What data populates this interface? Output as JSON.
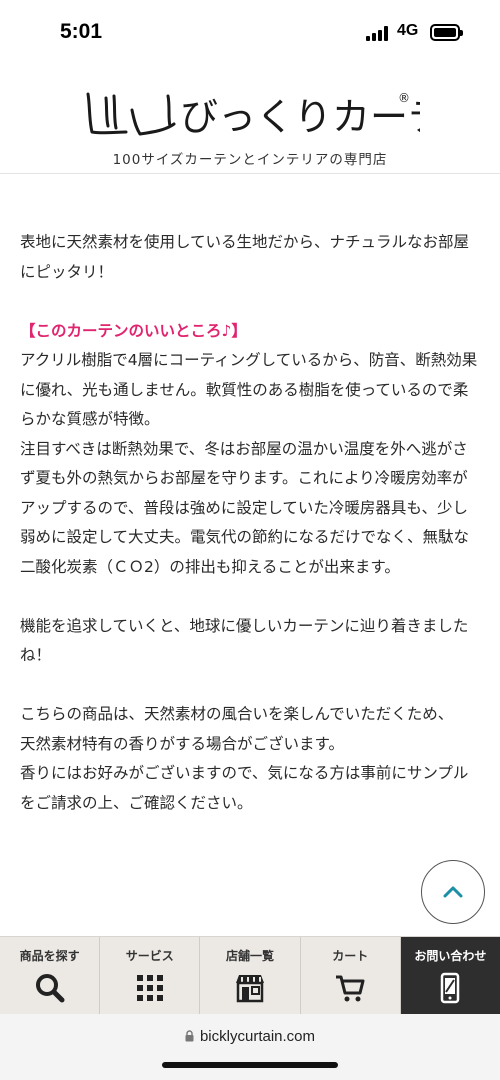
{
  "status_bar": {
    "time": "5:01",
    "network": "4G"
  },
  "header": {
    "tagline": "100サイズカーテンとインテリアの専門店",
    "logo_text": "びっくりカーテン",
    "logo_mark": "®"
  },
  "content": {
    "paragraph_1": "表地に天然素材を使用している生地だから、ナチュラルなお部屋にピッタリ！",
    "section_heading": "【このカーテンのいいところ♪】",
    "paragraph_2": "アクリル樹脂で4層にコーティングしているから、防音、断熱効果に優れ、光も通しません。軟質性のある樹脂を使っているので柔らかな質感が特徴。",
    "paragraph_3": "注目すべきは断熱効果で、冬はお部屋の温かい温度を外へ逃がさず夏も外の熱気からお部屋を守ります。これにより冷暖房効率がアップするので、普段は強めに設定していた冷暖房器具も、少し弱めに設定して大丈夫。電気代の節約になるだけでなく、無駄な二酸化炭素（ＣＯ2）の排出も抑えることが出来ます。",
    "paragraph_4": "機能を追求していくと、地球に優しいカーテンに辿り着きましたね！",
    "paragraph_5a": "こちらの商品は、天然素材の風合いを楽しんでいただくため、",
    "paragraph_5b": "天然素材特有の香りがする場合がございます。",
    "paragraph_5c": "香りにはお好みがございますので、気になる方は事前にサンプルをご請求の上、ご確認ください。"
  },
  "bottom_nav": {
    "items": [
      {
        "label": "商品を探す",
        "icon": "search-icon"
      },
      {
        "label": "サービス",
        "icon": "grid-icon"
      },
      {
        "label": "店舗一覧",
        "icon": "store-icon"
      },
      {
        "label": "カート",
        "icon": "cart-icon"
      },
      {
        "label": "お問い合わせ",
        "icon": "phone-icon"
      }
    ]
  },
  "url_bar": {
    "url": "bicklycurtain.com"
  },
  "colors": {
    "accent_pink": "#e0246f",
    "nav_background": "#ece9e5",
    "nav_dark": "#2e2e2e",
    "scroll_arrow": "#1a8fa8"
  }
}
